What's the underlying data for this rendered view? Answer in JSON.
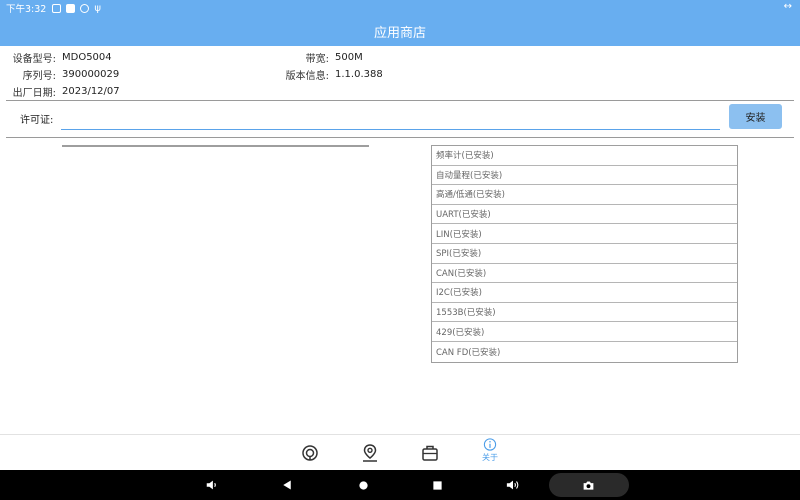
{
  "status_bar": {
    "time": "下午3:32",
    "right_glyph": "↔"
  },
  "app_bar": {
    "title": "应用商店"
  },
  "device_info": {
    "model_label": "设备型号:",
    "model_value": "MDO5004",
    "serial_label": "序列号:",
    "serial_value": "390000029",
    "date_label": "出厂日期:",
    "date_value": "2023/12/07",
    "bandwidth_label": "带宽:",
    "bandwidth_value": "500M",
    "version_label": "版本信息:",
    "version_value": "1.1.0.388"
  },
  "license": {
    "label": "许可证:",
    "value": "",
    "placeholder": "",
    "install_label": "安装"
  },
  "modules": [
    "频率计(已安装)",
    "自动量程(已安装)",
    "高通/低通(已安装)",
    "UART(已安装)",
    "LIN(已安装)",
    "SPI(已安装)",
    "CAN(已安装)",
    "I2C(已安装)",
    "1553B(已安装)",
    "429(已安装)",
    "CAN FD(已安装)"
  ],
  "bottom_nav": {
    "items": [
      {
        "icon": "app-store-icon",
        "label": ""
      },
      {
        "icon": "location-icon",
        "label": ""
      },
      {
        "icon": "toolbox-icon",
        "label": ""
      },
      {
        "icon": "info-icon",
        "label": "关于",
        "active": true
      }
    ]
  },
  "system_nav": {
    "icons": [
      "volume-down-icon",
      "back-icon",
      "home-icon",
      "recents-icon",
      "volume-up-icon",
      "camera-icon"
    ]
  },
  "colors": {
    "accent": "#68aef0",
    "button": "#8cc0f0",
    "active_nav": "#4a9ce8"
  }
}
